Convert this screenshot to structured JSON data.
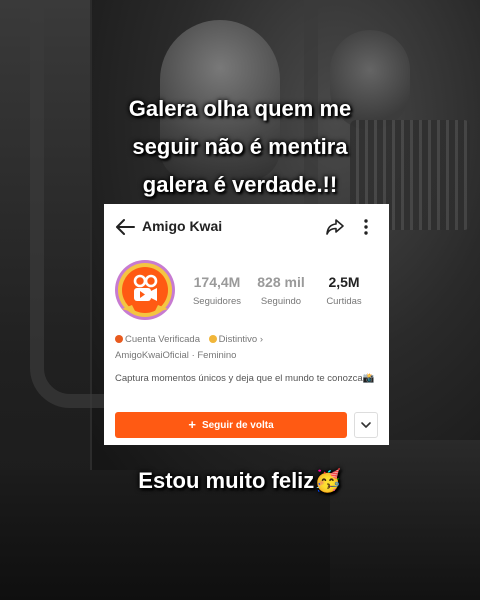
{
  "captions": {
    "top_lines": [
      "Galera olha quem me",
      "seguir não é mentira",
      "galera é verdade.!!"
    ],
    "bottom": "Estou muito feliz🥳"
  },
  "profile": {
    "name": "Amigo Kwai",
    "stats": [
      {
        "value": "174,4M",
        "label": "Seguidores"
      },
      {
        "value": "828 mil",
        "label": "Seguindo"
      },
      {
        "value": "2,5M",
        "label": "Curtidas"
      }
    ],
    "badge_verified": "Cuenta Verificada",
    "badge_distinct": "Distintivo",
    "handle": "AmigoKwaiOficial",
    "gender": "Feminino",
    "bio": "Captura momentos únicos y deja que el mundo te conozca📸",
    "follow_button": "Seguir de volta",
    "icons": {
      "back": "arrow-left-icon",
      "share": "share-icon",
      "more": "more-vertical-icon",
      "dropdown": "chevron-down-icon"
    }
  },
  "colors": {
    "accent": "#ff5a13",
    "badge_verified": "#e85a1e",
    "badge_distinct": "#f1b63a"
  }
}
